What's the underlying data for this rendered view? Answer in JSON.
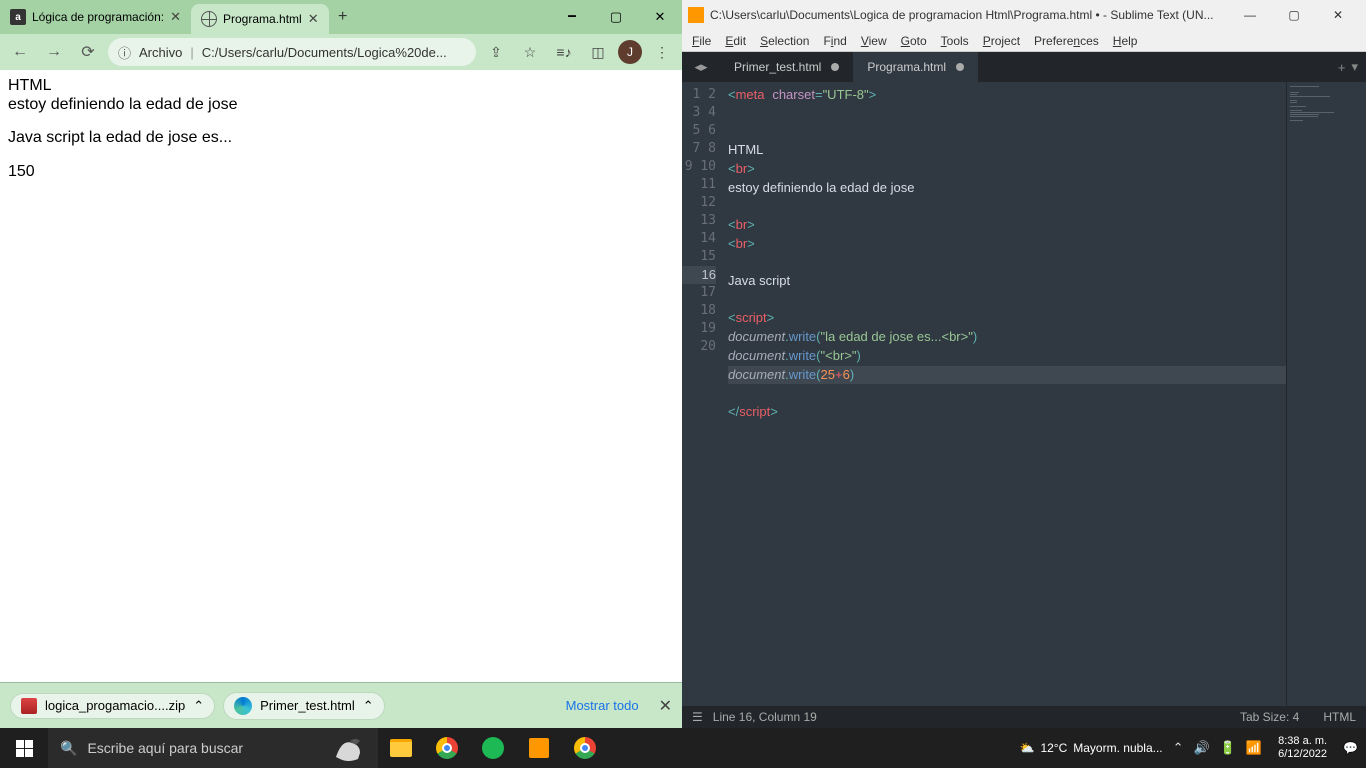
{
  "chrome": {
    "tabs": [
      {
        "title": "Lógica de programación:",
        "active": false
      },
      {
        "title": "Programa.html",
        "active": true
      }
    ],
    "address": {
      "prefix": "Archivo",
      "url": "C:/Users/carlu/Documents/Logica%20de..."
    },
    "avatar_initial": "J",
    "page": {
      "line1": "HTML",
      "line2": "estoy definiendo la edad de jose",
      "line3": "Java script la edad de jose es...",
      "line4": "150"
    },
    "downloads": {
      "items": [
        {
          "name": "logica_progamacio....zip"
        },
        {
          "name": "Primer_test.html"
        }
      ],
      "show_all": "Mostrar todo"
    }
  },
  "sublime": {
    "title": "C:\\Users\\carlu\\Documents\\Logica de programacion Html\\Programa.html • - Sublime Text (UN...",
    "menu": [
      "File",
      "Edit",
      "Selection",
      "Find",
      "View",
      "Goto",
      "Tools",
      "Project",
      "Preferences",
      "Help"
    ],
    "tabs": [
      {
        "name": "Primer_test.html",
        "active": false,
        "dirty": true
      },
      {
        "name": "Programa.html",
        "active": true,
        "dirty": true
      }
    ],
    "lines": {
      "l1_meta": "meta",
      "l1_charset": "charset",
      "l1_val": "\"UTF-8\"",
      "l4": "HTML",
      "l5_br": "br",
      "l6": "estoy definiendo la edad de jose",
      "l8_br": "br",
      "l9_br": "br",
      "l11": "Java script",
      "l13_script": "script",
      "l14_doc": "document",
      "l14_write": "write",
      "l14_str": "\"la edad de jose es...<br>\"",
      "l15_doc": "document",
      "l15_write": "write",
      "l15_str": "\"<br>\"",
      "l16_doc": "document",
      "l16_write": "write",
      "l16_a": "25",
      "l16_op": "+",
      "l16_b": "6",
      "l18_script": "script"
    },
    "status": {
      "left": "Line 16, Column 19",
      "tabsize": "Tab Size: 4",
      "syntax": "HTML"
    }
  },
  "taskbar": {
    "search_placeholder": "Escribe aquí para buscar",
    "weather": {
      "temp": "12°C",
      "desc": "Mayorm. nubla..."
    },
    "clock": {
      "time": "8:38 a. m.",
      "date": "6/12/2022"
    }
  }
}
